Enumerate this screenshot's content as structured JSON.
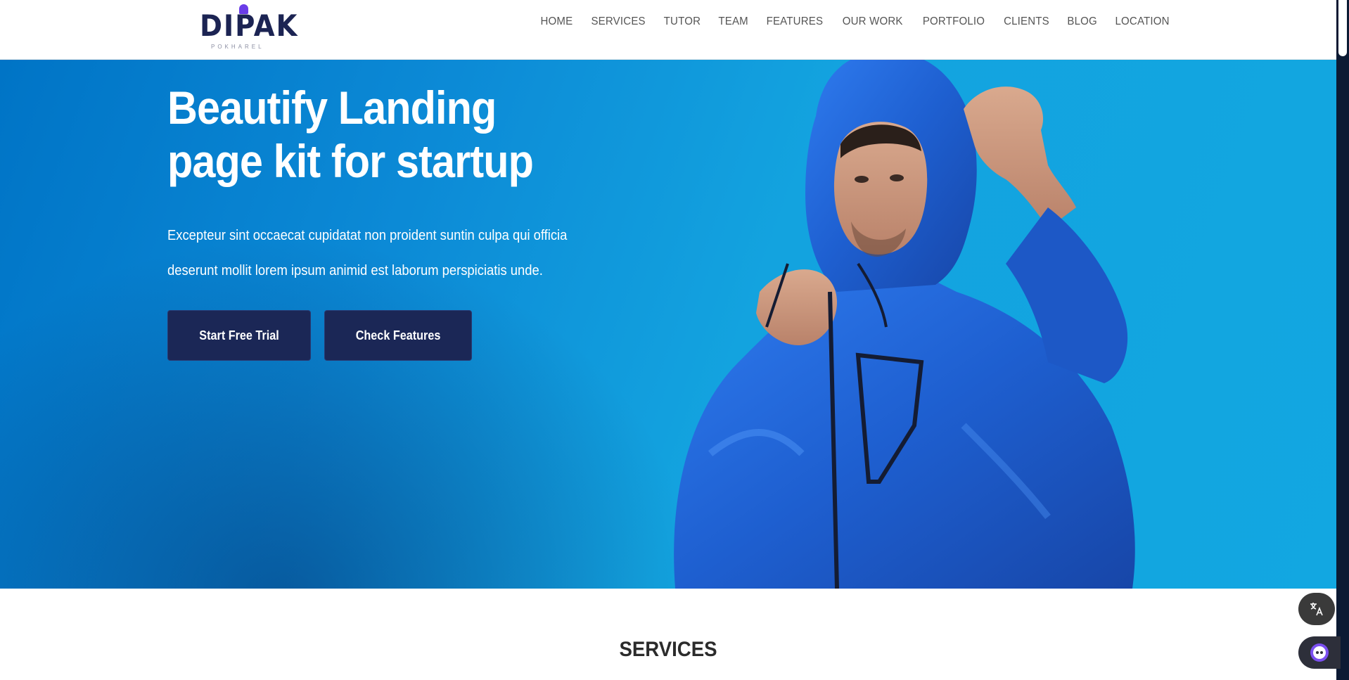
{
  "header": {
    "logo_text": "DIPAK",
    "logo_subtext": "POKHAREL",
    "nav": [
      {
        "label": "HOME"
      },
      {
        "label": "SERVICES"
      },
      {
        "label": "TUTOR"
      },
      {
        "label": "TEAM"
      },
      {
        "label": "FEATURES"
      },
      {
        "label": "OUR WORK"
      },
      {
        "label": "PORTFOLIO"
      },
      {
        "label": "CLIENTS"
      },
      {
        "label": "BLOG"
      },
      {
        "label": "LOCATION"
      }
    ]
  },
  "hero": {
    "title_line1": "Beautify Landing",
    "title_line2": "page kit for startup",
    "description_line1": "Excepteur sint occaecat cupidatat non proident suntin culpa qui officia",
    "description_line2": "deserunt mollit lorem ipsum animid est laborum perspiciatis unde.",
    "primary_button": "Start Free Trial",
    "secondary_button": "Check Features",
    "image_subject": "man-in-blue-hooded-jacket"
  },
  "services": {
    "heading": "SERVICES"
  },
  "widgets": {
    "translate_icon": "translate-icon",
    "assistant_icon": "assistant-icon"
  },
  "colors": {
    "brand_navy": "#1b2756",
    "logo_accent": "#6a3de8",
    "hero_blue": "#0c8ad6",
    "jacket_blue": "#1e5fd0"
  }
}
